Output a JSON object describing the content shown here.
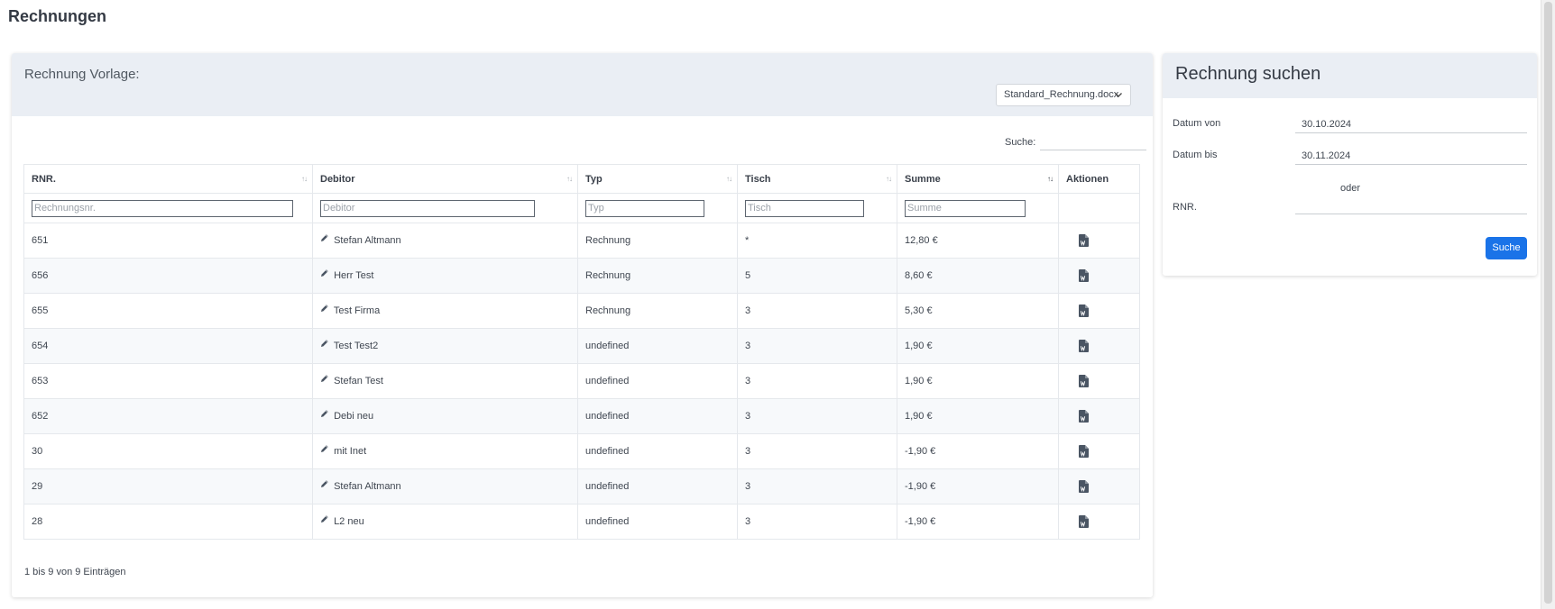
{
  "page": {
    "title": "Rechnungen"
  },
  "template_panel": {
    "label": "Rechnung Vorlage:",
    "selected_template": "Standard_Rechnung.docx"
  },
  "table_search": {
    "label": "Suche:",
    "value": ""
  },
  "table": {
    "headers": [
      "RNR.",
      "Debitor",
      "Typ",
      "Tisch",
      "Summe",
      "Aktionen"
    ],
    "filter_placeholders": [
      "Rechnungsnr.",
      "Debitor",
      "Typ",
      "Tisch",
      "Summe"
    ],
    "rows": [
      {
        "rnr": "651",
        "debitor": "Stefan Altmann",
        "typ": "Rechnung",
        "tisch": "*",
        "summe": "12,80 €"
      },
      {
        "rnr": "656",
        "debitor": "Herr Test",
        "typ": "Rechnung",
        "tisch": "5",
        "summe": "8,60 €"
      },
      {
        "rnr": "655",
        "debitor": "Test Firma",
        "typ": "Rechnung",
        "tisch": "3",
        "summe": "5,30 €"
      },
      {
        "rnr": "654",
        "debitor": "Test Test2",
        "typ": "undefined",
        "tisch": "3",
        "summe": "1,90 €"
      },
      {
        "rnr": "653",
        "debitor": "Stefan Test",
        "typ": "undefined",
        "tisch": "3",
        "summe": "1,90 €"
      },
      {
        "rnr": "652",
        "debitor": "Debi neu",
        "typ": "undefined",
        "tisch": "3",
        "summe": "1,90 €"
      },
      {
        "rnr": "30",
        "debitor": "mit Inet",
        "typ": "undefined",
        "tisch": "3",
        "summe": "-1,90 €"
      },
      {
        "rnr": "29",
        "debitor": "Stefan Altmann",
        "typ": "undefined",
        "tisch": "3",
        "summe": "-1,90 €"
      },
      {
        "rnr": "28",
        "debitor": "L2 neu",
        "typ": "undefined",
        "tisch": "3",
        "summe": "-1,90 €"
      }
    ],
    "info": "1 bis 9 von 9 Einträgen"
  },
  "search_panel": {
    "title": "Rechnung suchen",
    "date_from_label": "Datum von",
    "date_from_value": "30.10.2024",
    "date_to_label": "Datum bis",
    "date_to_value": "30.11.2024",
    "or_label": "oder",
    "rnr_label": "RNR.",
    "rnr_value": "",
    "button_label": "Suche"
  },
  "icons": {
    "edit": "pencil-icon",
    "action": "word-document-icon",
    "dropdown": "chevron-down-icon",
    "sort": "sort-arrows-icon"
  },
  "colors": {
    "primary_button": "#1a73e8",
    "card_header": "#eaeef4",
    "row_stripe": "#f7f9fb",
    "word_icon": "#4a5563"
  }
}
